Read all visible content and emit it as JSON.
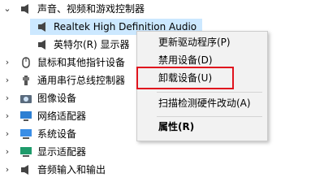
{
  "tree": {
    "audio_controllers": "声音、视频和游戏控制器",
    "realtek": "Realtek High Definition Audio",
    "intel_display": "英特尔(R) 显示器",
    "mice": "鼠标和其他指针设备",
    "usb": "通用串行总线控制器",
    "imaging": "图像设备",
    "network": "网络适配器",
    "system": "系统设备",
    "display": "显示适配器",
    "audio_io": "音频输入和输出"
  },
  "context_menu": {
    "update_driver": "更新驱动程序(P)",
    "disable_device": "禁用设备(D)",
    "uninstall_device": "卸载设备(U)",
    "scan_hardware": "扫描检测硬件改动(A)",
    "properties": "属性(R)"
  },
  "colors": {
    "selection": "#cce8ff",
    "highlight_box": "#e0141e"
  }
}
